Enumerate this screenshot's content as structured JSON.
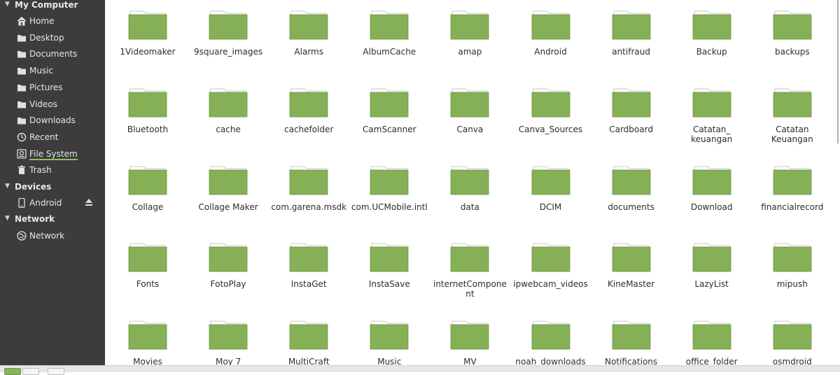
{
  "sidebar": {
    "my_computer": {
      "label": "My Computer",
      "items": [
        {
          "label": "Home",
          "icon": "home-icon"
        },
        {
          "label": "Desktop",
          "icon": "folder-icon"
        },
        {
          "label": "Documents",
          "icon": "folder-icon"
        },
        {
          "label": "Music",
          "icon": "folder-icon"
        },
        {
          "label": "Pictures",
          "icon": "folder-icon"
        },
        {
          "label": "Videos",
          "icon": "folder-icon"
        },
        {
          "label": "Downloads",
          "icon": "folder-icon"
        },
        {
          "label": "Recent",
          "icon": "recent-icon"
        },
        {
          "label": "File System",
          "icon": "drive-icon"
        },
        {
          "label": "Trash",
          "icon": "trash-icon"
        }
      ]
    },
    "devices": {
      "label": "Devices",
      "items": [
        {
          "label": "Android",
          "icon": "phone-icon"
        }
      ]
    },
    "network": {
      "label": "Network",
      "items": [
        {
          "label": "Network",
          "icon": "network-icon"
        }
      ]
    }
  },
  "folders": [
    [
      "1Videomaker",
      "9square_images",
      "Alarms",
      "AlbumCache",
      "amap",
      "Android",
      "antifraud",
      "Backup",
      "backups"
    ],
    [
      "Bluetooth",
      "cache",
      "cachefolder",
      "CamScanner",
      "Canva",
      "Canva_Sources",
      "Cardboard",
      "Catatan_\nkeuangan",
      "Catatan\nKeuangan"
    ],
    [
      "Collage",
      "Collage Maker",
      "com.garena.msdk",
      "com.UCMobile.intl",
      "data",
      "DCIM",
      "documents",
      "Download",
      "financialrecord"
    ],
    [
      "Fonts",
      "FotoPlay",
      "InstaGet",
      "InstaSave",
      "internetCompone\nnt",
      "ipwebcam_videos",
      "KineMaster",
      "LazyList",
      "mipush"
    ],
    [
      "Movies",
      "Moy 7",
      "MultiCraft",
      "Music",
      "MV",
      "noah_downloads",
      "Notifications",
      "office_folder",
      "osmdroid"
    ]
  ],
  "colors": {
    "sidebar_bg": "#3c3c3c",
    "folder_green": "#86b055",
    "accent": "#8fbf5a"
  }
}
